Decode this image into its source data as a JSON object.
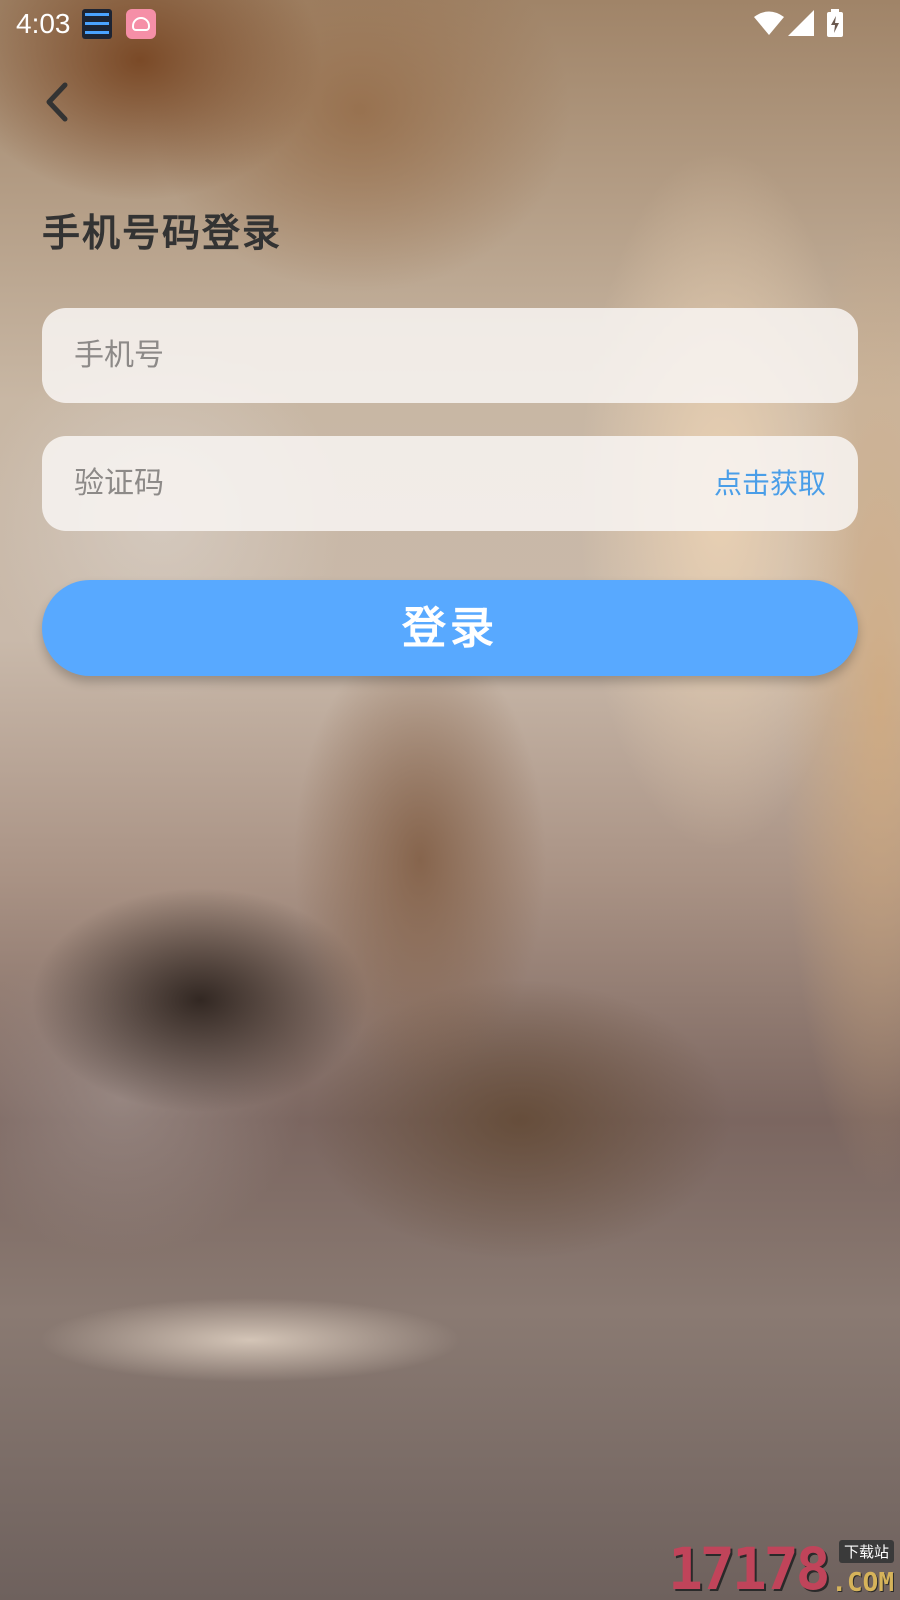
{
  "status_bar": {
    "time": "4:03",
    "notifications": [
      "clock-widget-icon",
      "app-notification-icon"
    ],
    "icons": [
      "wifi-icon",
      "signal-icon",
      "battery-charging-icon"
    ]
  },
  "header": {
    "back_icon": "chevron-left-icon",
    "title": "手机号码登录"
  },
  "form": {
    "phone": {
      "placeholder": "手机号",
      "value": ""
    },
    "code": {
      "placeholder": "验证码",
      "value": "",
      "get_code_label": "点击获取"
    },
    "login_label": "登录"
  },
  "colors": {
    "accent": "#58a9ff",
    "link": "#4a9ee8",
    "title": "#333333",
    "field_bg": "#f8f5f2"
  },
  "watermark": {
    "digits": "17178",
    "tag": "下载站",
    "domain": ".COM"
  }
}
